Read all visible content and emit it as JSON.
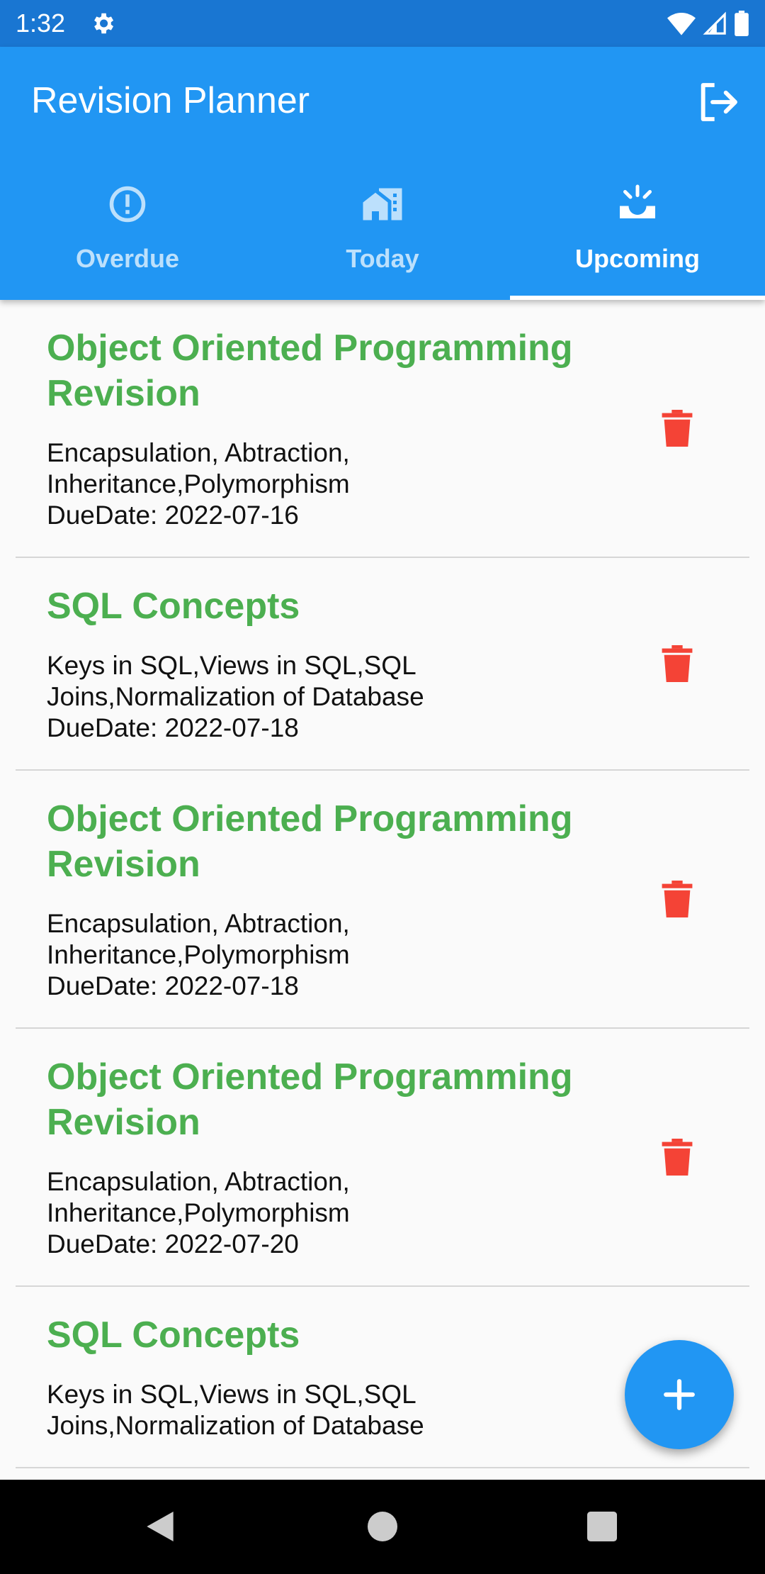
{
  "status_bar": {
    "time": "1:32",
    "icons": [
      "settings-icon",
      "wifi-icon",
      "signal-icon",
      "battery-icon"
    ]
  },
  "app_bar": {
    "title": "Revision Planner",
    "action_icon": "logout-icon"
  },
  "tabs": [
    {
      "label": "Overdue",
      "icon": "alert-circle-icon",
      "active": false
    },
    {
      "label": "Today",
      "icon": "home-work-icon",
      "active": false
    },
    {
      "label": "Upcoming",
      "icon": "upcoming-icon",
      "active": true
    }
  ],
  "items": [
    {
      "title": "Object Oriented Programming Revision",
      "description": "Encapsulation, Abtraction, Inheritance,Polymorphism",
      "due": "DueDate: 2022-07-16"
    },
    {
      "title": "SQL Concepts",
      "description": "Keys in SQL,Views in SQL,SQL Joins,Normalization of Database",
      "due": "DueDate: 2022-07-18"
    },
    {
      "title": "Object Oriented Programming Revision",
      "description": "Encapsulation, Abtraction, Inheritance,Polymorphism",
      "due": "DueDate: 2022-07-18"
    },
    {
      "title": "Object Oriented Programming Revision",
      "description": "Encapsulation, Abtraction, Inheritance,Polymorphism",
      "due": "DueDate: 2022-07-20"
    },
    {
      "title": "SQL Concepts",
      "description": "Keys in SQL,Views in SQL,SQL Joins,Normalization of Database",
      "due": ""
    }
  ],
  "fab": {
    "icon": "plus-icon"
  },
  "nav": [
    "back-icon",
    "home-icon",
    "recents-icon"
  ],
  "colors": {
    "primary": "#2196f3",
    "status_bar": "#1976d2",
    "title_green": "#4caf50",
    "delete_red": "#f44336"
  }
}
